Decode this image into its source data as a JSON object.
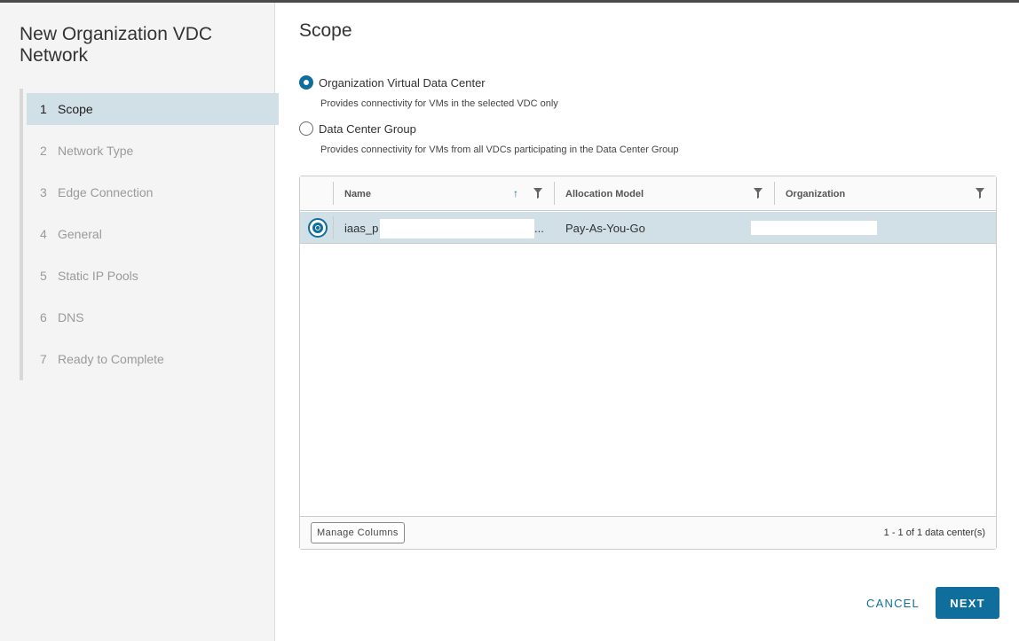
{
  "wizard": {
    "title": "New Organization VDC Network",
    "steps": [
      {
        "num": "1",
        "label": "Scope",
        "active": true
      },
      {
        "num": "2",
        "label": "Network Type",
        "active": false
      },
      {
        "num": "3",
        "label": "Edge Connection",
        "active": false
      },
      {
        "num": "4",
        "label": "General",
        "active": false
      },
      {
        "num": "5",
        "label": "Static IP Pools",
        "active": false
      },
      {
        "num": "6",
        "label": "DNS",
        "active": false
      },
      {
        "num": "7",
        "label": "Ready to Complete",
        "active": false
      }
    ]
  },
  "main": {
    "title": "Scope",
    "options": [
      {
        "label": "Organization Virtual Data Center",
        "help": "Provides connectivity for VMs in the selected VDC only",
        "checked": true
      },
      {
        "label": "Data Center Group",
        "help": "Provides connectivity for VMs from all VDCs participating in the Data Center Group",
        "checked": false
      }
    ]
  },
  "grid": {
    "columns": [
      "Name",
      "Allocation Model",
      "Organization"
    ],
    "sort_icon": "sort-ascending-icon",
    "filter_icon": "filter-icon",
    "rows": [
      {
        "name": "iaas_p",
        "name_suffix": "...",
        "allocation_model": "Pay-As-You-Go",
        "organization": "",
        "selected": true
      }
    ],
    "manage_columns_label": "Manage Columns",
    "count_text": "1 - 1 of 1 data center(s)"
  },
  "actions": {
    "cancel_label": "CANCEL",
    "next_label": "NEXT"
  },
  "colors": {
    "accent": "#0f6e9c",
    "selected_row": "#d1e0e6",
    "sidebar_bg": "#f4f4f4"
  }
}
